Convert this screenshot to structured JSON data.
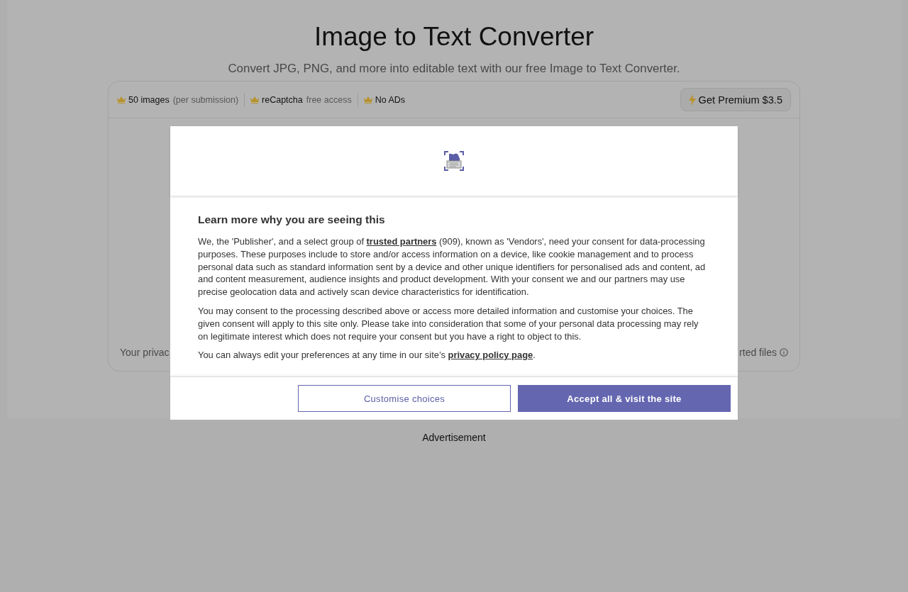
{
  "page": {
    "title": "Image to Text Converter",
    "subtitle": "Convert JPG, PNG, and more into editable text with our free Image to Text Converter."
  },
  "converter": {
    "features": [
      {
        "label": "50 images",
        "note": "(per submission)"
      },
      {
        "label": "reCaptcha",
        "note": "free access"
      },
      {
        "label": "No ADs"
      }
    ],
    "premium_button": {
      "label": "Get Premium $3.5"
    },
    "footer_left": "Your privac",
    "footer_right": "rted files"
  },
  "consent_dialog": {
    "heading": "Learn more why you are seeing this",
    "paragraphs": [
      {
        "text": "We, the 'Publisher', and a select group of ",
        "link": "trusted partners",
        "text_after": " (909), known as 'Vendors', need your consent for data-processing purposes. These purposes include to store and/or access information on a device, like cookie management and to process personal data such as standard information sent by a device and other unique identifiers for personalised ads and content, ad and content measurement, audience insights and product development. With your consent we and our partners may use precise geolocation data and actively scan device characteristics for identification."
      },
      {
        "text": "You may consent to the processing described above or access more detailed information and customise your choices. The given consent will apply to this site only. Please take into consideration that some of your personal data processing may rely on legitimate interest which does not require your consent but you have a right to object to this."
      },
      {
        "text": "You can always edit your preferences at any time in our site’s ",
        "link": "privacy policy page",
        "text_after": "."
      }
    ],
    "buttons": [
      {
        "label": "Customise choices",
        "kind": "secondary"
      },
      {
        "label": "Accept all & visit the site",
        "kind": "primary"
      }
    ]
  },
  "advertisement": {
    "label": "Advertisement"
  }
}
